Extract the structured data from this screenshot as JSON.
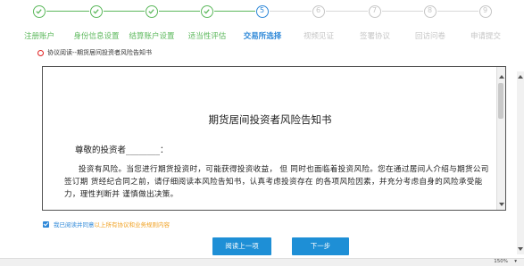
{
  "steps": [
    {
      "num": "1",
      "label": "注册账户",
      "state": "done"
    },
    {
      "num": "2",
      "label": "身份信息设置",
      "state": "done"
    },
    {
      "num": "3",
      "label": "结算账户设置",
      "state": "done"
    },
    {
      "num": "4",
      "label": "适当性评估",
      "state": "done"
    },
    {
      "num": "5",
      "label": "交易所选择",
      "state": "active"
    },
    {
      "num": "6",
      "label": "视频见证",
      "state": "todo"
    },
    {
      "num": "7",
      "label": "签署协议",
      "state": "todo"
    },
    {
      "num": "8",
      "label": "回访问卷",
      "state": "todo"
    },
    {
      "num": "9",
      "label": "申请提交",
      "state": "todo"
    }
  ],
  "colors": {
    "done": "#5cb85c",
    "active": "#2e88d8",
    "todo": "#c6c6c6"
  },
  "agreement": {
    "heading": "协议阅读--期货居间投资者风险告知书"
  },
  "document": {
    "title": "期货居间投资者风险告知书",
    "greeting": "尊敬的投资者________：",
    "body": "投资有风险。当您进行期货投资时，可能获得投资收益， 但 同时也面临着投资风险。您在通过居间人介绍与期货公司签订期 货经纪合同之前，请仔细阅读本风险告知书，认真考虑投资存在 的各项风险因素，并充分考虑自身的风险承受能力，理性判断并 谨慎做出决策。"
  },
  "consent": {
    "text": "我已阅读并同意",
    "link": "以上所有协议和业务规则内容"
  },
  "buttons": {
    "read_prev": "阅读上一项",
    "next": "下一步"
  },
  "statusbar": {
    "zoom": "150%"
  }
}
